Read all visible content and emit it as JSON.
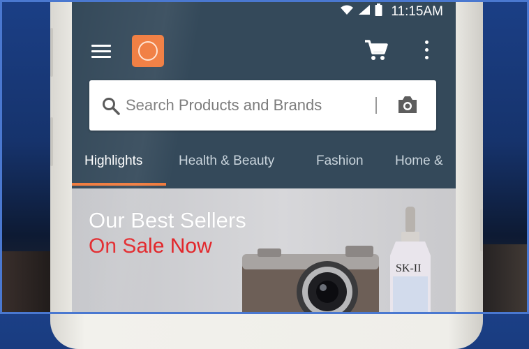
{
  "status_bar": {
    "time": "11:15AM",
    "icons": [
      "wifi-icon",
      "signal-icon",
      "battery-icon"
    ]
  },
  "app_bar": {
    "icons": [
      "menu-icon",
      "app-logo",
      "cart-icon",
      "more-vert-icon"
    ]
  },
  "search": {
    "placeholder": "Search Products and Brands",
    "camera_icon": "camera-icon"
  },
  "tabs": [
    {
      "label": "Highlights",
      "active": true
    },
    {
      "label": "Health & Beauty",
      "active": false
    },
    {
      "label": "Fashion",
      "active": false
    },
    {
      "label": "Home &",
      "active": false
    }
  ],
  "banner": {
    "title": "Our Best Sellers",
    "subtitle": "On Sale Now",
    "product_labels": [
      "SK-II"
    ]
  },
  "colors": {
    "appbar": "#34495a",
    "accent_orange": "#f07a3c",
    "sale_red": "#e2262a",
    "tab_inactive": "#c9d4dc"
  }
}
